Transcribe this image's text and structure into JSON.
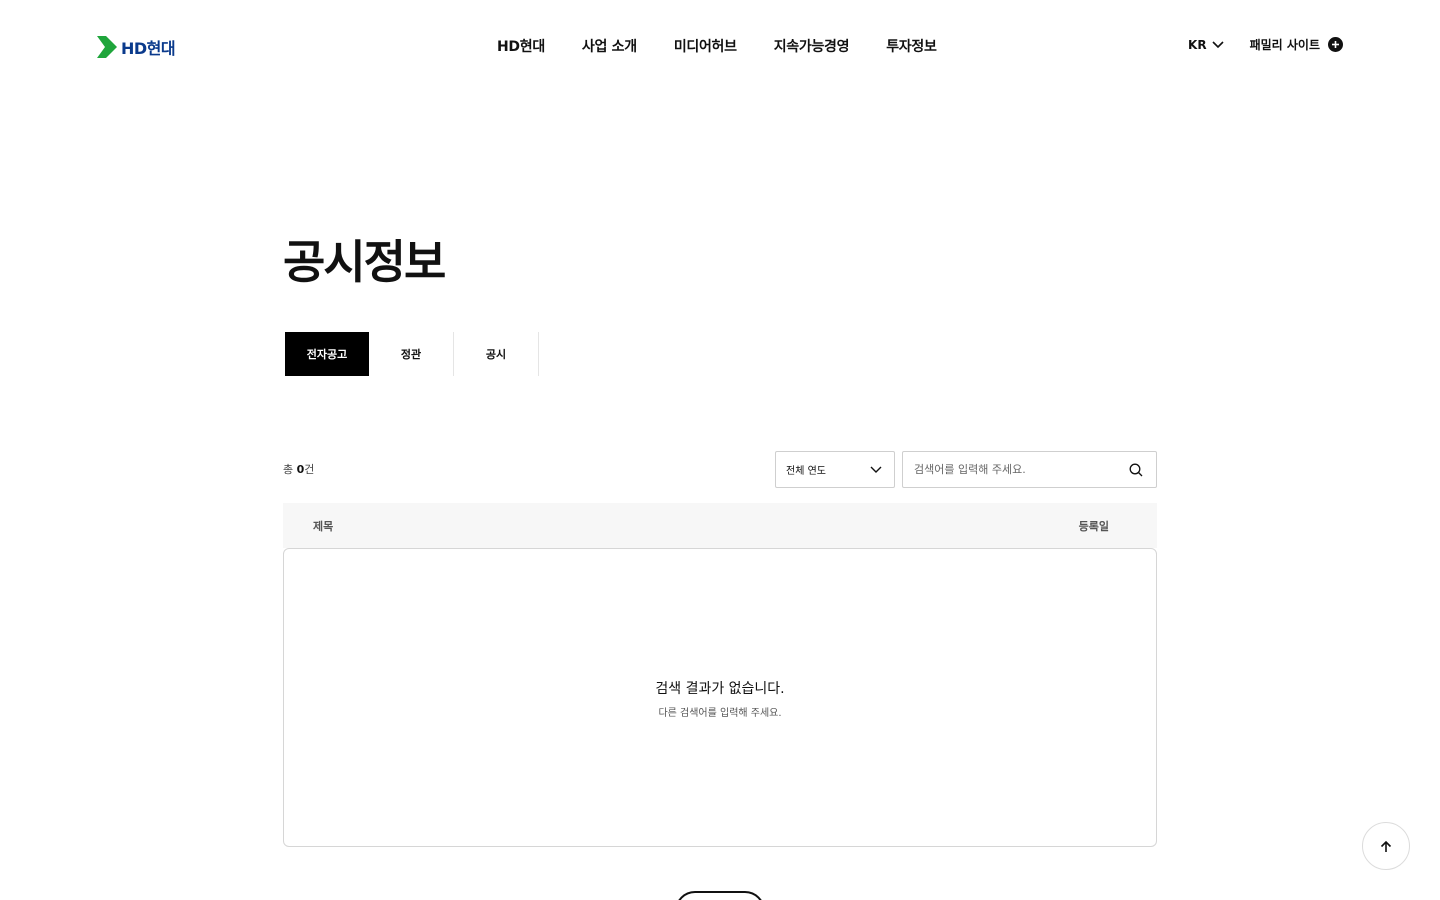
{
  "header": {
    "logo_text": "HD현대",
    "brand_color": "#0a3a8c",
    "mark_color": "#1fa53b",
    "nav": [
      "HD현대",
      "사업 소개",
      "미디어허브",
      "지속가능경영",
      "투자정보"
    ],
    "lang_label": "KR",
    "family_site_label": "패밀리 사이트"
  },
  "page": {
    "title": "공시정보"
  },
  "tabs": [
    {
      "label": "전자공고",
      "active": true
    },
    {
      "label": "정관",
      "active": false
    },
    {
      "label": "공시",
      "active": false
    }
  ],
  "toolbar": {
    "count_prefix": "총 ",
    "count_value": "0",
    "count_suffix": "건",
    "year_select": "전체 연도",
    "search_placeholder": "검색어를 입력해 주세요."
  },
  "table": {
    "col_title": "제목",
    "col_date": "등록일",
    "empty_message": "검색 결과가 없습니다.",
    "empty_hint": "다른 검색어를 입력해 주세요."
  },
  "icons": {
    "lang_chevron": "chevron-down-icon",
    "family_plus": "plus-circle-icon",
    "select_chevron": "chevron-down-icon",
    "search": "search-icon",
    "top": "arrow-up-icon"
  }
}
